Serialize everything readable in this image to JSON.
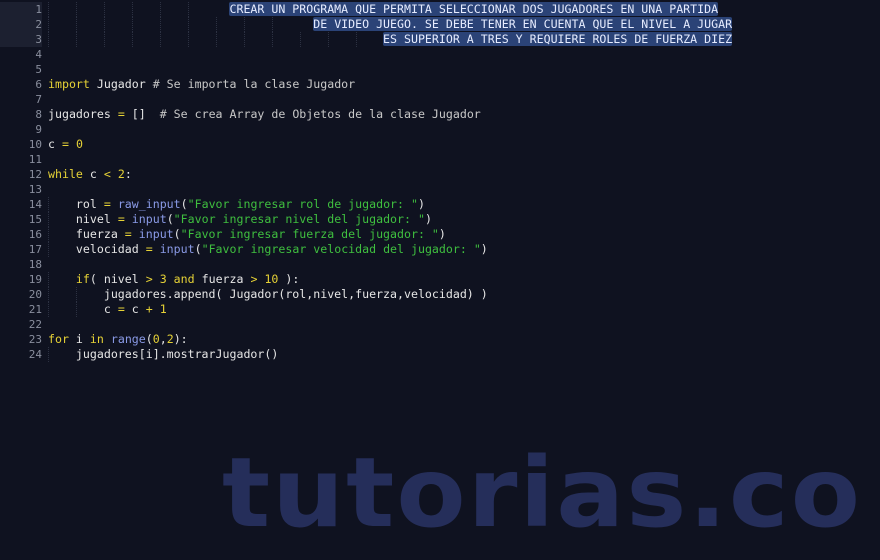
{
  "editor": {
    "colors": {
      "background": "#0f1220",
      "selection": "#2b4377",
      "keyword": "#e6d236",
      "string": "#3fbf3f",
      "builtin": "#8a9ae6",
      "text": "#e6e6e6",
      "line_number": "#8a8f9e"
    },
    "lines": [
      {
        "n": "1",
        "tokens": [
          {
            "t": "                          "
          },
          {
            "t": "CREAR UN PROGRAMA QUE PERMITA SELECCIONAR DOS JUGADORES EN UNA PARTIDA",
            "c": "sel"
          }
        ]
      },
      {
        "n": "2",
        "tokens": [
          {
            "t": "                                      "
          },
          {
            "t": "DE VIDEO JUEGO. SE DEBE TENER EN CUENTA QUE EL NIVEL A JUGAR",
            "c": "sel"
          }
        ]
      },
      {
        "n": "3",
        "tokens": [
          {
            "t": "                                                "
          },
          {
            "t": "ES SUPERIOR A TRES Y REQUIERE ROLES DE FUERZA DIEZ",
            "c": "sel"
          }
        ]
      },
      {
        "n": "4",
        "tokens": []
      },
      {
        "n": "5",
        "tokens": []
      },
      {
        "n": "6",
        "tokens": [
          {
            "t": "import",
            "c": "kw"
          },
          {
            "t": " Jugador "
          },
          {
            "t": "# Se importa la clase Jugador",
            "c": "cm"
          }
        ]
      },
      {
        "n": "7",
        "tokens": []
      },
      {
        "n": "8",
        "tokens": [
          {
            "t": "jugadores "
          },
          {
            "t": "=",
            "c": "op"
          },
          {
            "t": " []  "
          },
          {
            "t": "# Se crea Array de Objetos de la clase Jugador",
            "c": "cm"
          }
        ]
      },
      {
        "n": "9",
        "tokens": []
      },
      {
        "n": "10",
        "tokens": [
          {
            "t": "c "
          },
          {
            "t": "=",
            "c": "op"
          },
          {
            "t": " "
          },
          {
            "t": "0",
            "c": "num"
          }
        ]
      },
      {
        "n": "11",
        "tokens": []
      },
      {
        "n": "12",
        "tokens": [
          {
            "t": "while",
            "c": "kw"
          },
          {
            "t": " c "
          },
          {
            "t": "<",
            "c": "op"
          },
          {
            "t": " "
          },
          {
            "t": "2",
            "c": "num"
          },
          {
            "t": ":"
          }
        ]
      },
      {
        "n": "13",
        "tokens": []
      },
      {
        "n": "14",
        "tokens": [
          {
            "t": "    rol "
          },
          {
            "t": "=",
            "c": "op"
          },
          {
            "t": " "
          },
          {
            "t": "raw_input",
            "c": "fn"
          },
          {
            "t": "("
          },
          {
            "t": "\"Favor ingresar rol de jugador: \"",
            "c": "str"
          },
          {
            "t": ")"
          }
        ]
      },
      {
        "n": "15",
        "tokens": [
          {
            "t": "    nivel "
          },
          {
            "t": "=",
            "c": "op"
          },
          {
            "t": " "
          },
          {
            "t": "input",
            "c": "fn"
          },
          {
            "t": "("
          },
          {
            "t": "\"Favor ingresar nivel del jugador: \"",
            "c": "str"
          },
          {
            "t": ")"
          }
        ]
      },
      {
        "n": "16",
        "tokens": [
          {
            "t": "    fuerza "
          },
          {
            "t": "=",
            "c": "op"
          },
          {
            "t": " "
          },
          {
            "t": "input",
            "c": "fn"
          },
          {
            "t": "("
          },
          {
            "t": "\"Favor ingresar fuerza del jugador: \"",
            "c": "str"
          },
          {
            "t": ")"
          }
        ]
      },
      {
        "n": "17",
        "tokens": [
          {
            "t": "    velocidad "
          },
          {
            "t": "=",
            "c": "op"
          },
          {
            "t": " "
          },
          {
            "t": "input",
            "c": "fn"
          },
          {
            "t": "("
          },
          {
            "t": "\"Favor ingresar velocidad del jugador: \"",
            "c": "str"
          },
          {
            "t": ")"
          }
        ]
      },
      {
        "n": "18",
        "tokens": []
      },
      {
        "n": "19",
        "tokens": [
          {
            "t": "    "
          },
          {
            "t": "if",
            "c": "kw"
          },
          {
            "t": "( nivel "
          },
          {
            "t": ">",
            "c": "op"
          },
          {
            "t": " "
          },
          {
            "t": "3",
            "c": "num"
          },
          {
            "t": " "
          },
          {
            "t": "and",
            "c": "kw"
          },
          {
            "t": " fuerza "
          },
          {
            "t": ">",
            "c": "op"
          },
          {
            "t": " "
          },
          {
            "t": "10",
            "c": "num"
          },
          {
            "t": " ):"
          }
        ]
      },
      {
        "n": "20",
        "tokens": [
          {
            "t": "        jugadores.append( Jugador(rol,nivel,fuerza,velocidad) )"
          }
        ]
      },
      {
        "n": "21",
        "tokens": [
          {
            "t": "        c "
          },
          {
            "t": "=",
            "c": "op"
          },
          {
            "t": " c "
          },
          {
            "t": "+",
            "c": "op"
          },
          {
            "t": " "
          },
          {
            "t": "1",
            "c": "num"
          }
        ]
      },
      {
        "n": "22",
        "tokens": []
      },
      {
        "n": "23",
        "tokens": [
          {
            "t": "for",
            "c": "kw"
          },
          {
            "t": " i "
          },
          {
            "t": "in",
            "c": "kw"
          },
          {
            "t": " "
          },
          {
            "t": "range",
            "c": "fn"
          },
          {
            "t": "("
          },
          {
            "t": "0",
            "c": "num"
          },
          {
            "t": ","
          },
          {
            "t": "2",
            "c": "num"
          },
          {
            "t": "):"
          }
        ]
      },
      {
        "n": "24",
        "tokens": [
          {
            "t": "    jugadores[i].mostrarJugador()"
          }
        ]
      }
    ],
    "active_gutter_lines": [
      "1",
      "2",
      "3"
    ]
  },
  "watermark": {
    "text": "tutorias.co"
  }
}
